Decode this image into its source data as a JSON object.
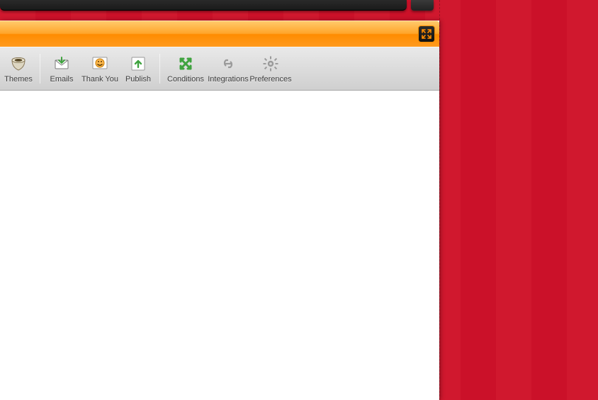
{
  "toolbar": {
    "group_a": [
      {
        "label": "Themes",
        "icon": "themes-icon"
      },
      {
        "label": "Emails",
        "icon": "emails-icon"
      },
      {
        "label": "Thank You",
        "icon": "thankyou-icon"
      },
      {
        "label": "Publish",
        "icon": "publish-icon"
      }
    ],
    "group_b": [
      {
        "label": "Conditions",
        "icon": "conditions-icon"
      },
      {
        "label": "Integrations",
        "icon": "integrations-icon"
      },
      {
        "label": "Preferences",
        "icon": "preferences-icon"
      }
    ]
  },
  "titlebar": {
    "expand_title": "Expand"
  }
}
